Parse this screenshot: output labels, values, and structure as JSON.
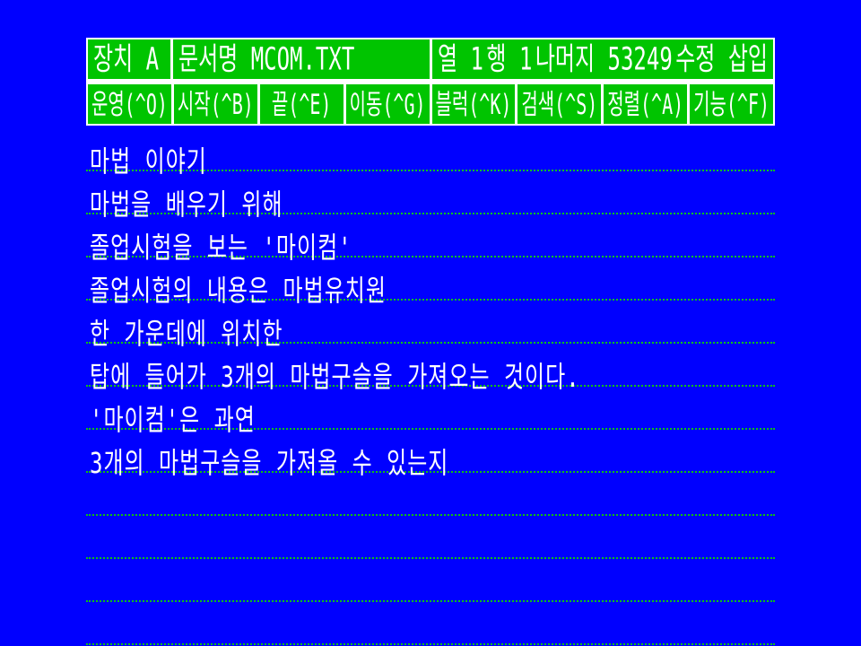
{
  "status_bar": {
    "drive": "장치 A",
    "document": "문서명 MCOM.TXT",
    "column": "열 1",
    "row": "행 1",
    "remaining": "나머지 53249",
    "mode": "수정 삽입"
  },
  "menu": {
    "items": [
      {
        "label": "운영(^O)"
      },
      {
        "label": "시작(^B)"
      },
      {
        "label": "끝(^E)"
      },
      {
        "label": "이동(^G)"
      },
      {
        "label": "블럭(^K)"
      },
      {
        "label": "검색(^S)"
      },
      {
        "label": "정렬(^A)"
      },
      {
        "label": "기능(^F)"
      }
    ]
  },
  "document": {
    "lines": [
      "마법 이야기",
      "마법을 배우기 위해",
      "졸업시험을 보는 '마이컴'",
      "졸업시험의 내용은 마법유치원",
      "한 가운데에 위치한",
      "탑에 들어가 3개의 마법구슬을 가져오는 것이다.",
      "'마이컴'은 과연",
      "3개의 마법구슬을 가져올 수 있는지",
      "",
      "",
      "",
      ""
    ]
  },
  "colors": {
    "background": "#0000ff",
    "panel_cell": "#00c400",
    "panel_border": "#ffffff",
    "text": "#ffffff",
    "line_rule": "#10c010"
  }
}
